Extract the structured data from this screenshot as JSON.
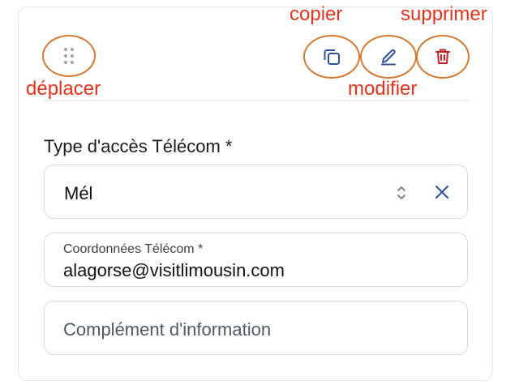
{
  "annotations": {
    "copy": "copier",
    "delete": "supprimer",
    "move": "déplacer",
    "edit": "modifier"
  },
  "colors": {
    "annotation_text": "#e4331c",
    "annotation_circle": "#d27a33",
    "icon": "#2f4f9b"
  },
  "icons": {
    "drag": "drag-handle-icon",
    "copy": "copy-icon",
    "edit": "pencil-icon",
    "delete": "trash-icon",
    "sort": "sort-icon",
    "clear": "close-icon"
  },
  "form": {
    "access_type_label": "Type d'accès Télécom *",
    "access_type_value": "Mél",
    "coordinates_label": "Coordonnées Télécom *",
    "coordinates_value": "alagorse@visitlimousin.com",
    "complement_placeholder": "Complément d'information"
  }
}
